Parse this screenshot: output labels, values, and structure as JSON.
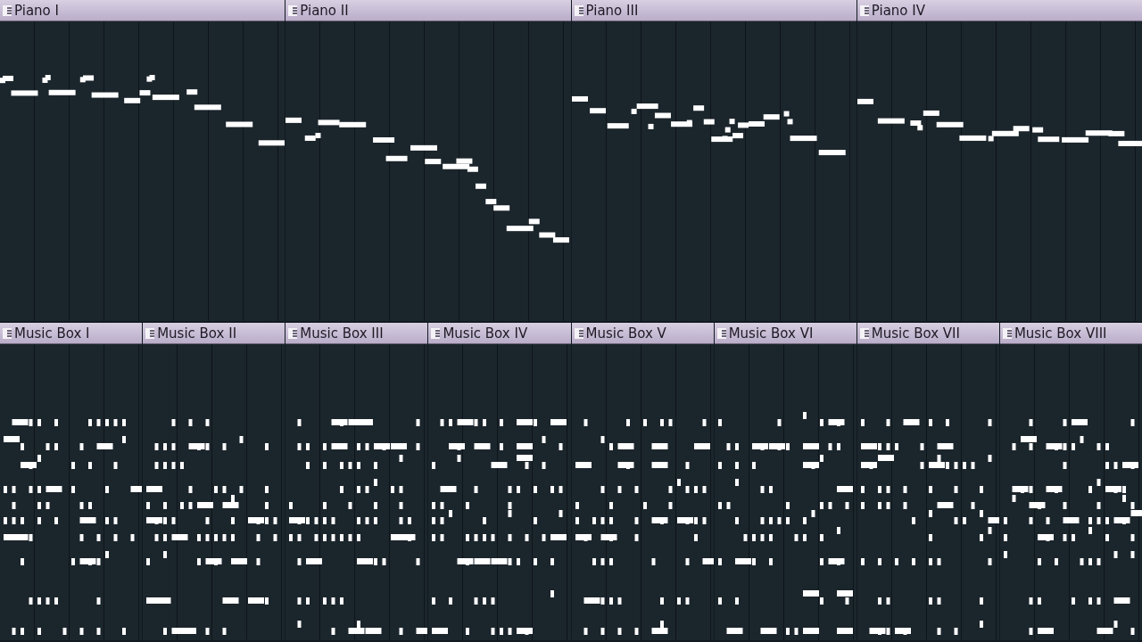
{
  "tracks": [
    {
      "clips": [
        {
          "title": "Piano I"
        },
        {
          "title": "Piano II"
        },
        {
          "title": "Piano III"
        },
        {
          "title": "Piano IV"
        }
      ]
    },
    {
      "clips": [
        {
          "title": "Music Box I"
        },
        {
          "title": "Music Box II"
        },
        {
          "title": "Music Box III"
        },
        {
          "title": "Music Box IV"
        },
        {
          "title": "Music Box V"
        },
        {
          "title": "Music Box VI"
        },
        {
          "title": "Music Box VII"
        },
        {
          "title": "Music Box VIII"
        }
      ]
    }
  ]
}
